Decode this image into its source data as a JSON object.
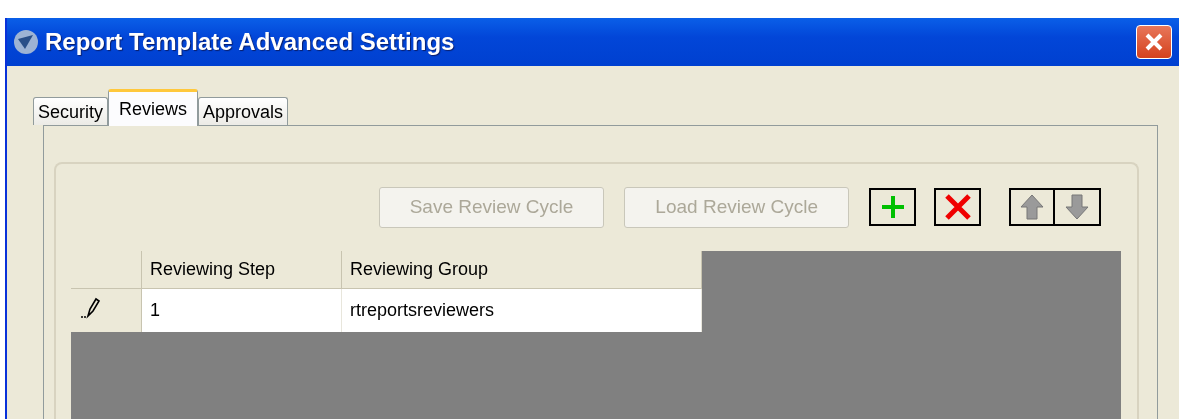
{
  "window": {
    "title": "Report Template Advanced Settings"
  },
  "tabs": [
    {
      "label": "Security",
      "selected": false
    },
    {
      "label": "Reviews",
      "selected": true
    },
    {
      "label": "Approvals",
      "selected": false
    }
  ],
  "toolbar": {
    "buttons": [
      {
        "label": "Save Review Cycle",
        "disabled": true
      },
      {
        "label": "Load Review Cycle",
        "disabled": true
      }
    ]
  },
  "grid": {
    "columns": [
      "Reviewing Step",
      "Reviewing Group"
    ],
    "rows": [
      {
        "editing": true,
        "cells": [
          "1",
          "rtreportsreviewers"
        ]
      }
    ]
  }
}
